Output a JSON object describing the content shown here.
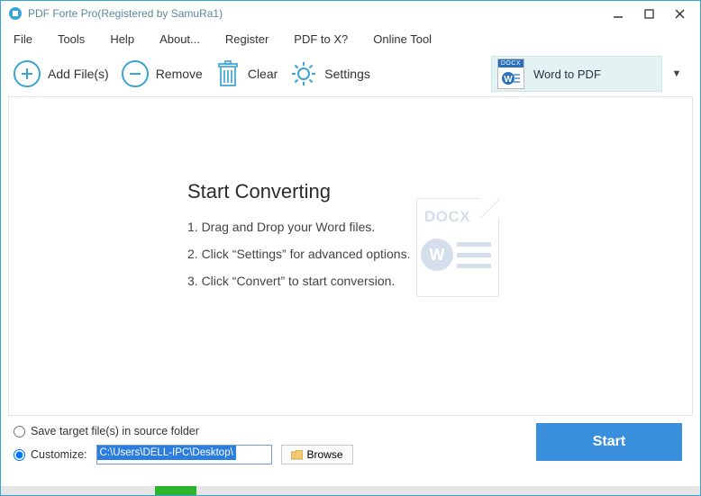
{
  "titlebar": {
    "title": "PDF Forte Pro(Registered by SamuRa1)"
  },
  "menu": {
    "file": "File",
    "tools": "Tools",
    "help": "Help",
    "about": "About...",
    "register": "Register",
    "pdftox": "PDF to X?",
    "online": "Online Tool"
  },
  "toolbar": {
    "add_label": "Add File(s)",
    "remove_label": "Remove",
    "clear_label": "Clear",
    "settings_label": "Settings"
  },
  "mode": {
    "icon_text": "DOCX",
    "label": "Word to PDF"
  },
  "main": {
    "heading": "Start Converting",
    "step1": "1. Drag and Drop your Word files.",
    "step2": "2. Click “Settings” for advanced options.",
    "step3": "3. Click “Convert” to start conversion.",
    "watermark_docx": "DOCX",
    "watermark_w": "W"
  },
  "bottom": {
    "save_source_label": "Save target file(s) in source folder",
    "customize_label": "Customize:",
    "path_value": "C:\\Users\\DELL-IPC\\Desktop\\",
    "browse_label": "Browse",
    "start_label": "Start",
    "selected": "customize"
  },
  "progress": {
    "start_pct": 22,
    "width_pct": 6
  }
}
